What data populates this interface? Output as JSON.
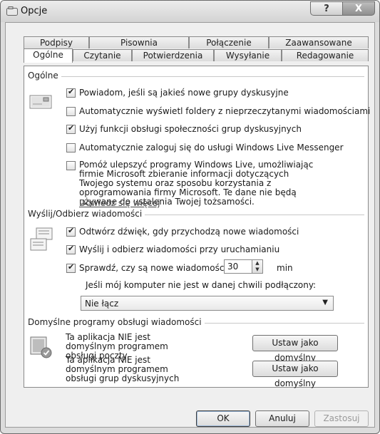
{
  "window": {
    "title": "Opcje",
    "help_glyph": "?",
    "close_glyph": "X"
  },
  "tabs_row1": [
    "Podpisy",
    "Pisownia",
    "Połączenie",
    "Zaawansowane"
  ],
  "tabs_row2": [
    "Ogólne",
    "Czytanie",
    "Potwierdzenia",
    "Wysyłanie",
    "Redagowanie"
  ],
  "active_tab": "Ogólne",
  "general": {
    "title": "Ogólne",
    "options": [
      {
        "label": "Powiadom, jeśli są jakieś nowe grupy dyskusyjne",
        "checked": true
      },
      {
        "label": "Automatycznie wyświetl foldery z nieprzeczytanymi wiadomościami",
        "checked": false
      },
      {
        "label": "Użyj funkcji obsługi społeczności grup dyskusyjnych",
        "checked": true
      },
      {
        "label": "Automatycznie zaloguj się do usługi Windows Live Messenger",
        "checked": false
      },
      {
        "label": "Pomóż ulepszyć programy Windows Live, umożliwiając firmie Microsoft zbieranie informacji dotyczących Twojego systemu oraz sposobu korzystania z oprogramowania firmy Microsoft. Te dane nie będą używane do ustalenia Twojej tożsamości.",
        "checked": false
      }
    ],
    "learn_more": "Dowiedz się więcej"
  },
  "send_receive": {
    "title": "Wyślij/Odbierz wiadomości",
    "options": [
      {
        "label": "Odtwórz dźwięk, gdy przychodzą nowe wiadomości",
        "checked": true
      },
      {
        "label": "Wyślij i odbierz wiadomości przy uruchamianiu",
        "checked": true
      },
      {
        "label": "Sprawdź, czy są nowe wiadomości co",
        "checked": true
      }
    ],
    "interval_value": "30",
    "interval_unit": "min",
    "offline_label": "Jeśli mój komputer nie jest w danej chwili podłączony:",
    "offline_value": "Nie łącz"
  },
  "default_programs": {
    "title": "Domyślne programy obsługi wiadomości",
    "mail_text": "Ta aplikacja NIE jest domyślnym programem obsługi poczty",
    "news_text": "Ta aplikacja NIE jest domyślnym programem obsługi grup dyskusyjnych",
    "set_default_label": "Ustaw jako domyślny"
  },
  "buttons": {
    "ok": "OK",
    "cancel": "Anuluj",
    "apply": "Zastosuj"
  }
}
